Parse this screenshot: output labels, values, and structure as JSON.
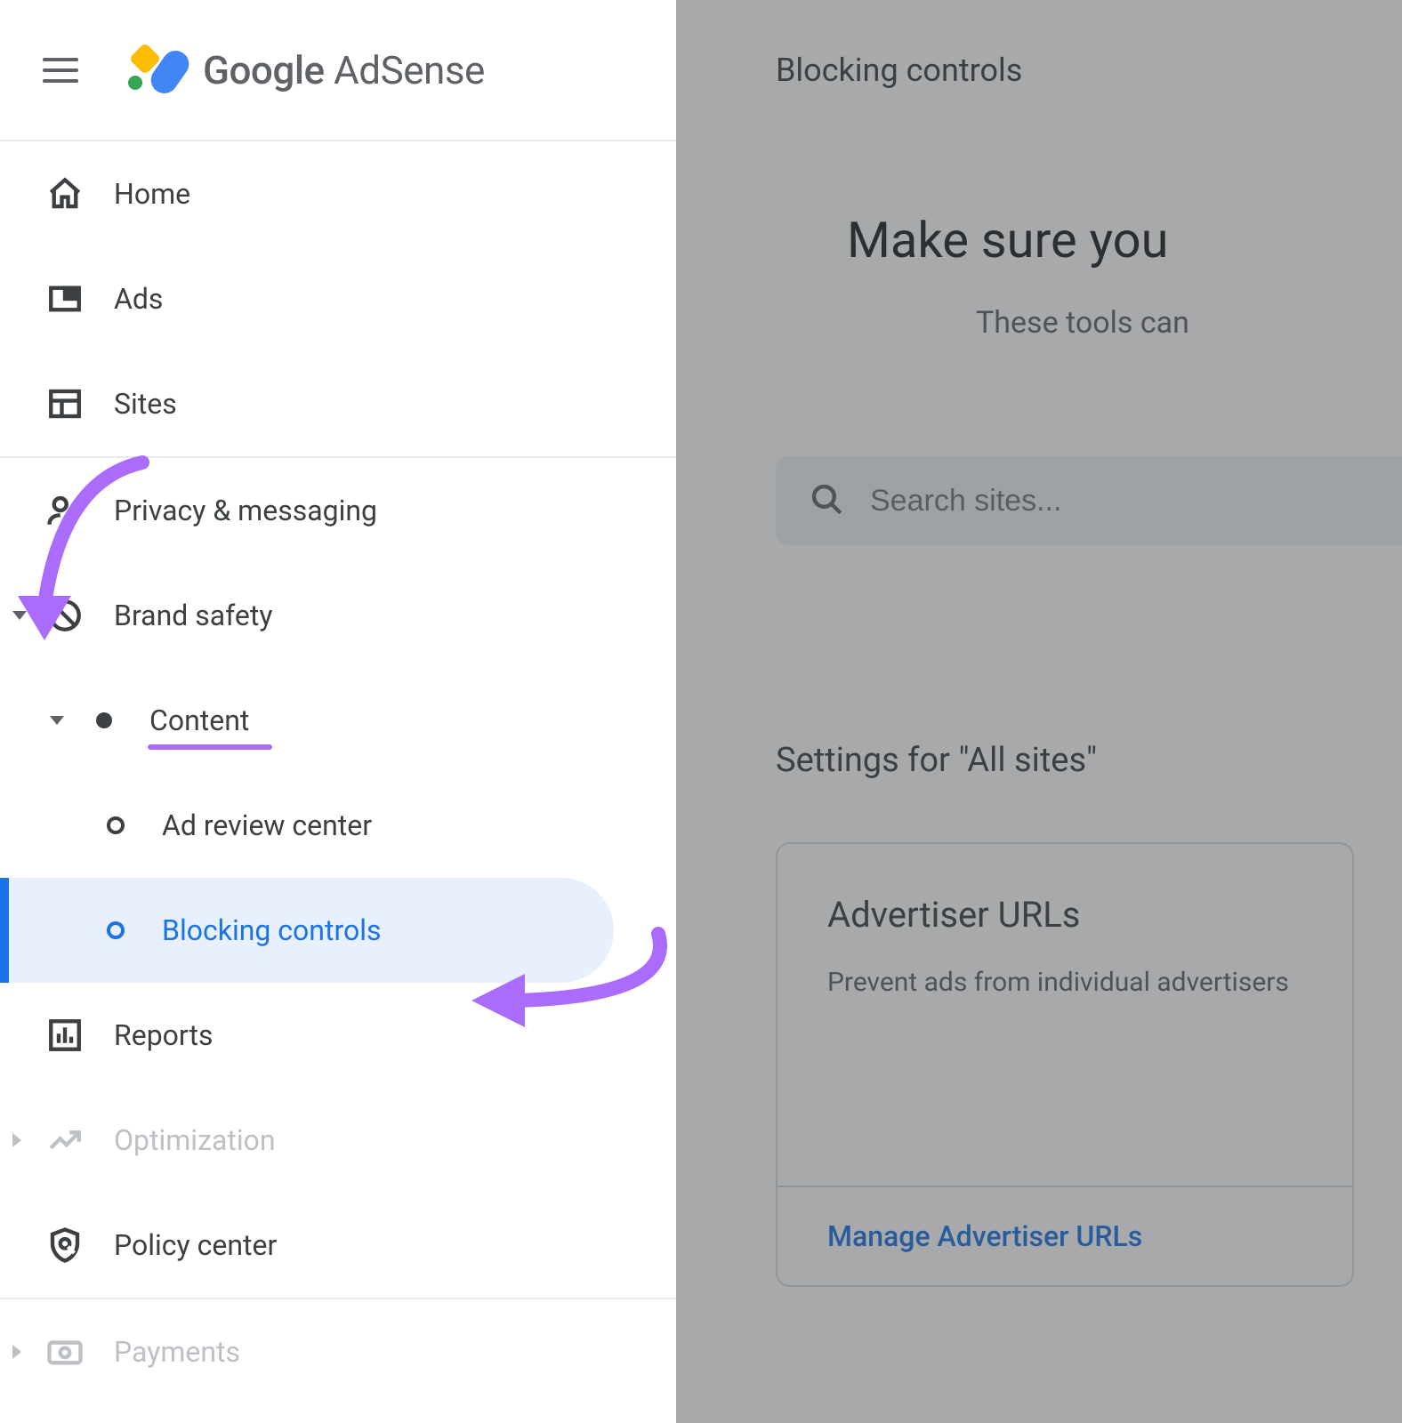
{
  "header": {
    "brand_google": "Google",
    "brand_product": " AdSense"
  },
  "sidebar": {
    "home": "Home",
    "ads": "Ads",
    "sites": "Sites",
    "privacy": "Privacy & messaging",
    "brand_safety": "Brand safety",
    "content": "Content",
    "ad_review": "Ad review center",
    "blocking": "Blocking controls",
    "reports": "Reports",
    "optimization": "Optimization",
    "policy": "Policy center",
    "payments": "Payments"
  },
  "main": {
    "page_title": "Blocking controls",
    "hero_title": "Make sure you",
    "hero_sub": "These tools can",
    "search_placeholder": "Search sites...",
    "settings_heading": "Settings for \"All sites\"",
    "card": {
      "title": "Advertiser URLs",
      "desc": "Prevent ads from individual advertisers",
      "action": "Manage Advertiser URLs"
    }
  }
}
